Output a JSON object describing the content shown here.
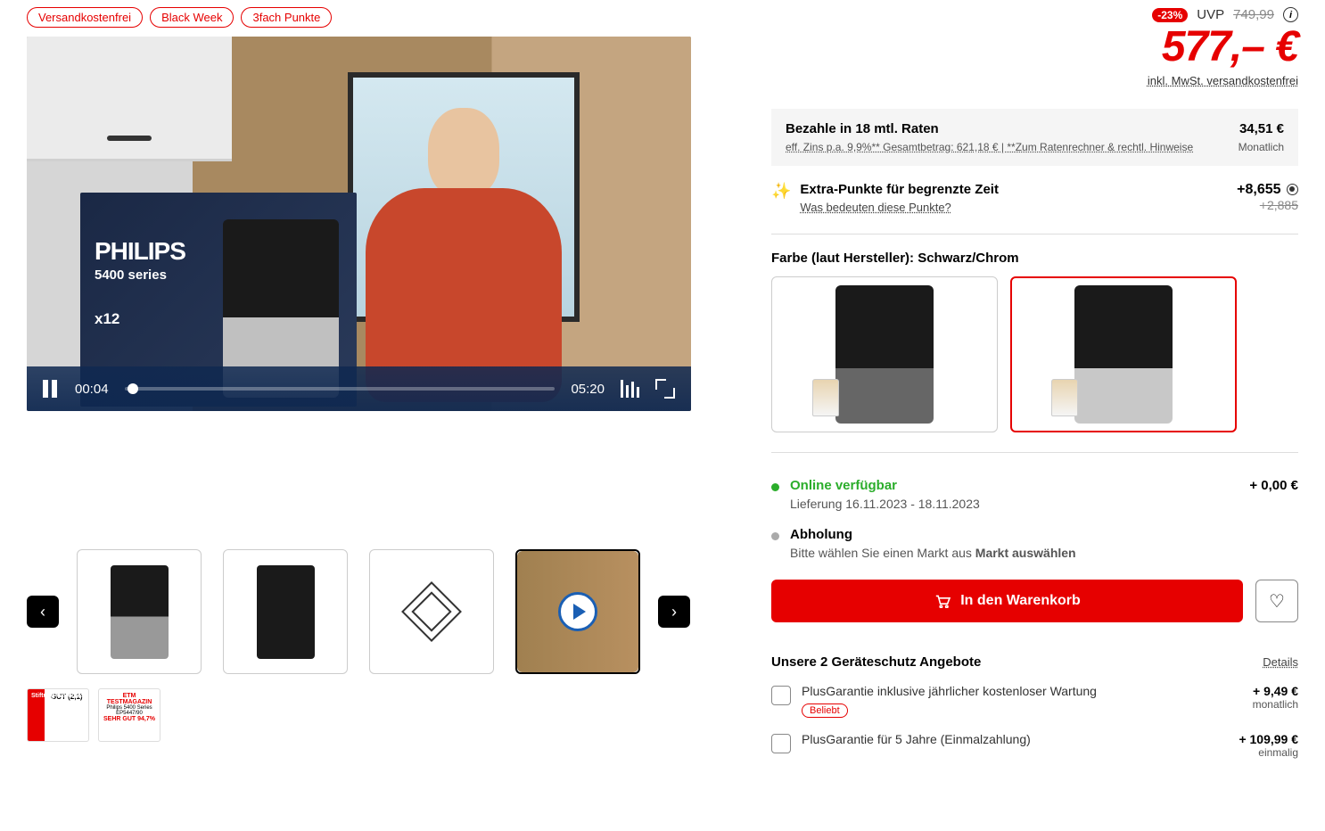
{
  "badges": [
    "Versandkostenfrei",
    "Black Week",
    "3fach Punkte"
  ],
  "video": {
    "brand": "PHILIPS",
    "series": "5400 series",
    "x12": "x12",
    "current_time": "00:04",
    "duration": "05:20"
  },
  "certs": {
    "c1_header": "Stiftung Warentest",
    "c1_score": "GUT (2,1)",
    "c2_header": "ETM TESTMAGAZIN",
    "c2_model": "Philips 5400 Series EP5447/90",
    "c2_rating": "SEHR GUT 94,7%"
  },
  "price": {
    "discount_badge": "-23%",
    "uvp_label": "UVP",
    "old": "749,99",
    "current": "577,– €",
    "sub": "inkl. MwSt. versandkostenfrei"
  },
  "finance": {
    "title": "Bezahle in 18 mtl. Raten",
    "rate": "34,51 €",
    "sub_left": "eff. Zins p.a. 9,9%** Gesamtbetrag: 621,18 € | **Zum Ratenrechner & rechtl. Hinweise",
    "sub_right": "Monatlich"
  },
  "points": {
    "title": "Extra-Punkte für begrenzte Zeit",
    "link": "Was bedeuten diese Punkte?",
    "new": "+8,655",
    "old": "+2,885"
  },
  "variants": {
    "title": "Farbe (laut Hersteller): Schwarz/Chrom"
  },
  "availability": {
    "online_status": "Online verfügbar",
    "online_sub": "Lieferung 16.11.2023 - 18.11.2023",
    "online_price": "+ 0,00 €",
    "pickup_title": "Abholung",
    "pickup_sub_prefix": "Bitte wählen Sie einen Markt aus ",
    "pickup_link": "Markt auswählen"
  },
  "cta": {
    "add": "In den Warenkorb"
  },
  "warranty": {
    "title": "Unsere 2 Geräteschutz Angebote",
    "details": "Details",
    "opt1_label": "PlusGarantie inklusive jährlicher kostenloser Wartung",
    "opt1_badge": "Beliebt",
    "opt1_price": "+ 9,49 €",
    "opt1_freq": "monatlich",
    "opt2_label": "PlusGarantie für 5 Jahre (Einmalzahlung)",
    "opt2_price": "+ 109,99 €",
    "opt2_freq": "einmalig"
  }
}
